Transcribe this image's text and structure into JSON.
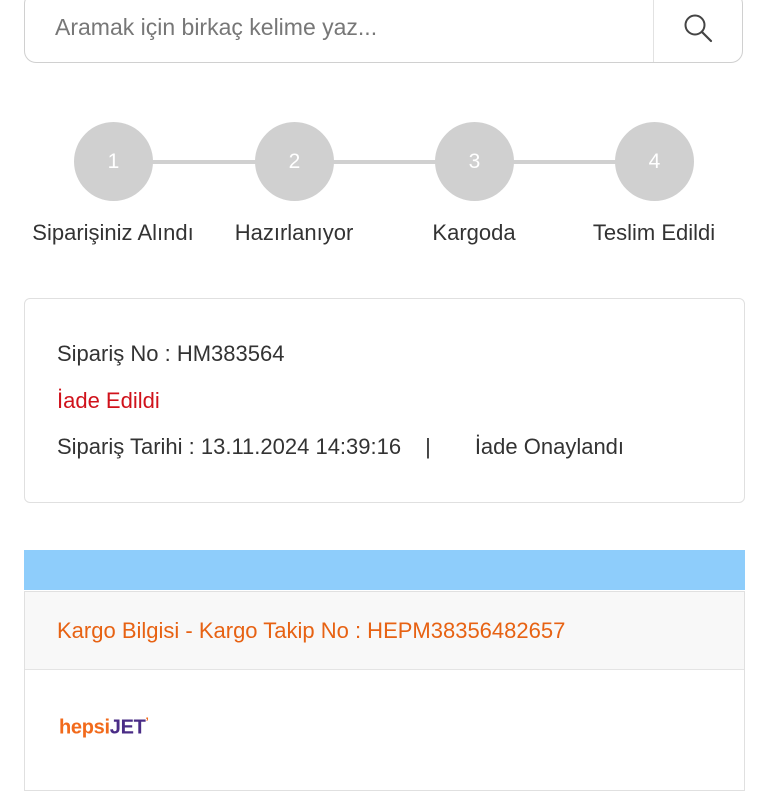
{
  "search": {
    "placeholder": "Aramak için birkaç kelime yaz...",
    "icon": "search-icon"
  },
  "steps": [
    {
      "number": "1",
      "label": "Siparişiniz Alındı"
    },
    {
      "number": "2",
      "label": "Hazırlanıyor"
    },
    {
      "number": "3",
      "label": "Kargoda"
    },
    {
      "number": "4",
      "label": "Teslim Edildi"
    }
  ],
  "order": {
    "order_no": "Sipariş No : HM383564",
    "status": "İade Edildi",
    "date": "Sipariş Tarihi : 13.11.2024 14:39:16",
    "separator": "|",
    "return_status": "İade Onaylandı"
  },
  "cargo": {
    "header": "Kargo Bilgisi - Kargo Takip No : HEPM38356482657",
    "logo_part1": "hepsi",
    "logo_part2": "JET",
    "logo_mark": "’"
  },
  "colors": {
    "step_inactive": "#d0d0d0",
    "status_red": "#d0121b",
    "cargo_orange": "#e76213",
    "banner_blue": "#8ecdfb"
  }
}
